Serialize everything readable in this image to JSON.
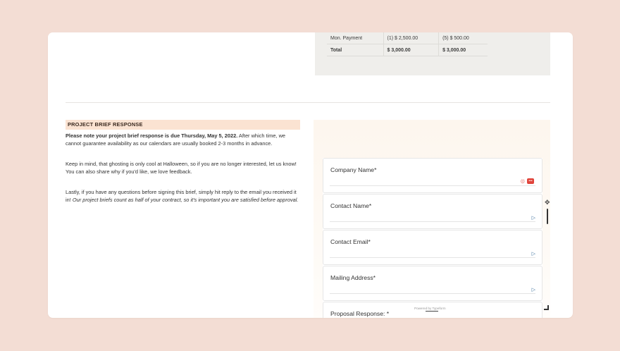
{
  "payment_table": {
    "rows": [
      {
        "label": "Mon. Payment",
        "col1": "(1) $ 2,500.00",
        "col2": "(5) $ 500.00"
      },
      {
        "label": "Total",
        "col1": "$ 3,000.00",
        "col2": "$ 3,000.00"
      }
    ]
  },
  "brief": {
    "header": "PROJECT BRIEF RESPONSE",
    "p1_bold": "Please note your project brief response is due Thursday, May 5, 2022.",
    "p1_rest": " After which time, we cannot guarantee availability as our calendars are usually booked 2-3 months in advance.",
    "p2": "Keep in mind, that ghosting is only cool at Halloween, so if you are no longer interested, let us know! You can also share why if you'd like, we love feedback.",
    "p3_start": "Lastly, if you have any questions before signing this brief, simply hit reply to the email you received it in! ",
    "p3_italic": "Our project briefs count as half of your contract, so it's important you are satisfied before approval."
  },
  "form": {
    "fields": [
      {
        "label": "Company Name*"
      },
      {
        "label": "Contact Name*"
      },
      {
        "label": "Contact Email*"
      },
      {
        "label": "Mailing Address*"
      },
      {
        "label": "Proposal Response: *"
      }
    ],
    "powered_by": "Powered by Typeform",
    "arrow_glyph": "▷",
    "pw_glyph": "•••"
  },
  "colors": {
    "page_bg": "#f3ddd4",
    "header_bg": "#fbe3d2",
    "table_bg": "#efeeeb",
    "password_manager_icon": "#e0443b"
  }
}
